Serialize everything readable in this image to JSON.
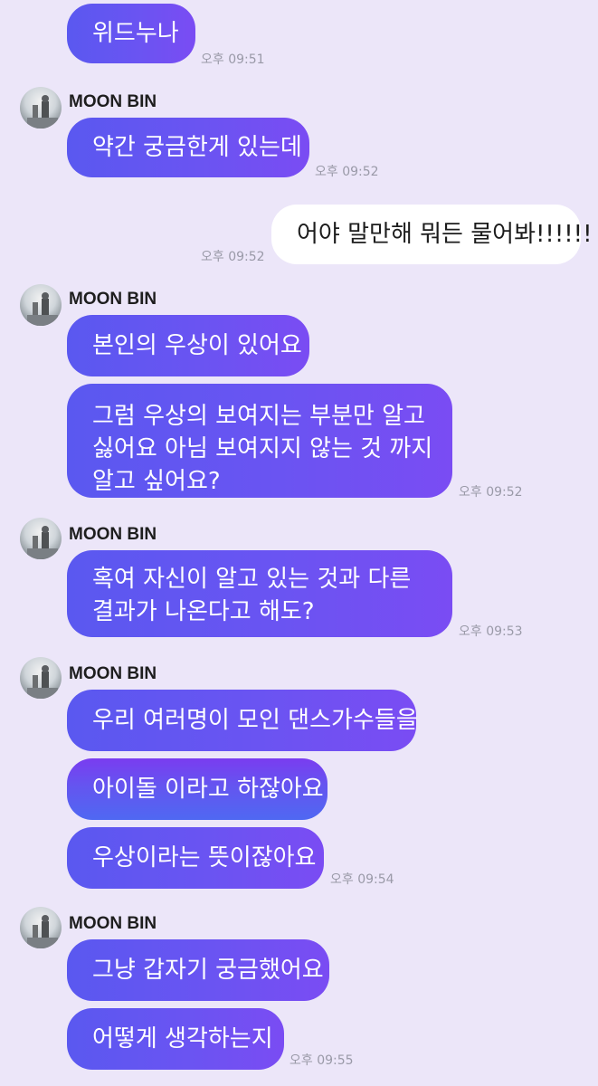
{
  "messages": {
    "m1": {
      "text": "위드누나",
      "time": "오후 09:51"
    },
    "g1": {
      "sender": "MOON BIN",
      "text": "약간 궁금한게 있는데",
      "time": "오후 09:52"
    },
    "m2": {
      "text": "어야 말만해 뭐든 물어봐!!!!!!",
      "time": "오후 09:52"
    },
    "g2": {
      "sender": "MOON BIN",
      "b1": "본인의 우상이 있어요",
      "b2": [
        "그럼 우상의 보여지는 부분만 알고",
        "싫어요 아님 보여지지 않는 것 까지",
        "알고 싶어요?"
      ],
      "time": "오후 09:52"
    },
    "g3": {
      "sender": "MOON BIN",
      "b1": [
        "혹여 자신이 알고 있는 것과 다른",
        "결과가 나온다고 해도?"
      ],
      "time": "오후 09:53"
    },
    "g4": {
      "sender": "MOON BIN",
      "b1": "우리 여러명이 모인 댄스가수들을",
      "b2": "아이돌 이라고 하잖아요",
      "b3": "우상이라는 뜻이잖아요",
      "time": "오후 09:54"
    },
    "g5": {
      "sender": "MOON BIN",
      "b1": "그냥 갑자기 궁금했어요",
      "b2": "어떻게 생각하는지",
      "time": "오후 09:55"
    }
  },
  "colors": {
    "background": "#ece6f9",
    "bubble_start": "#5a58f0",
    "bubble_end": "#7a4cf3",
    "my_bubble": "#ffffff",
    "timestamp": "#9a9aa8"
  },
  "icons": {
    "avatar": "profile-photo-avatar"
  }
}
